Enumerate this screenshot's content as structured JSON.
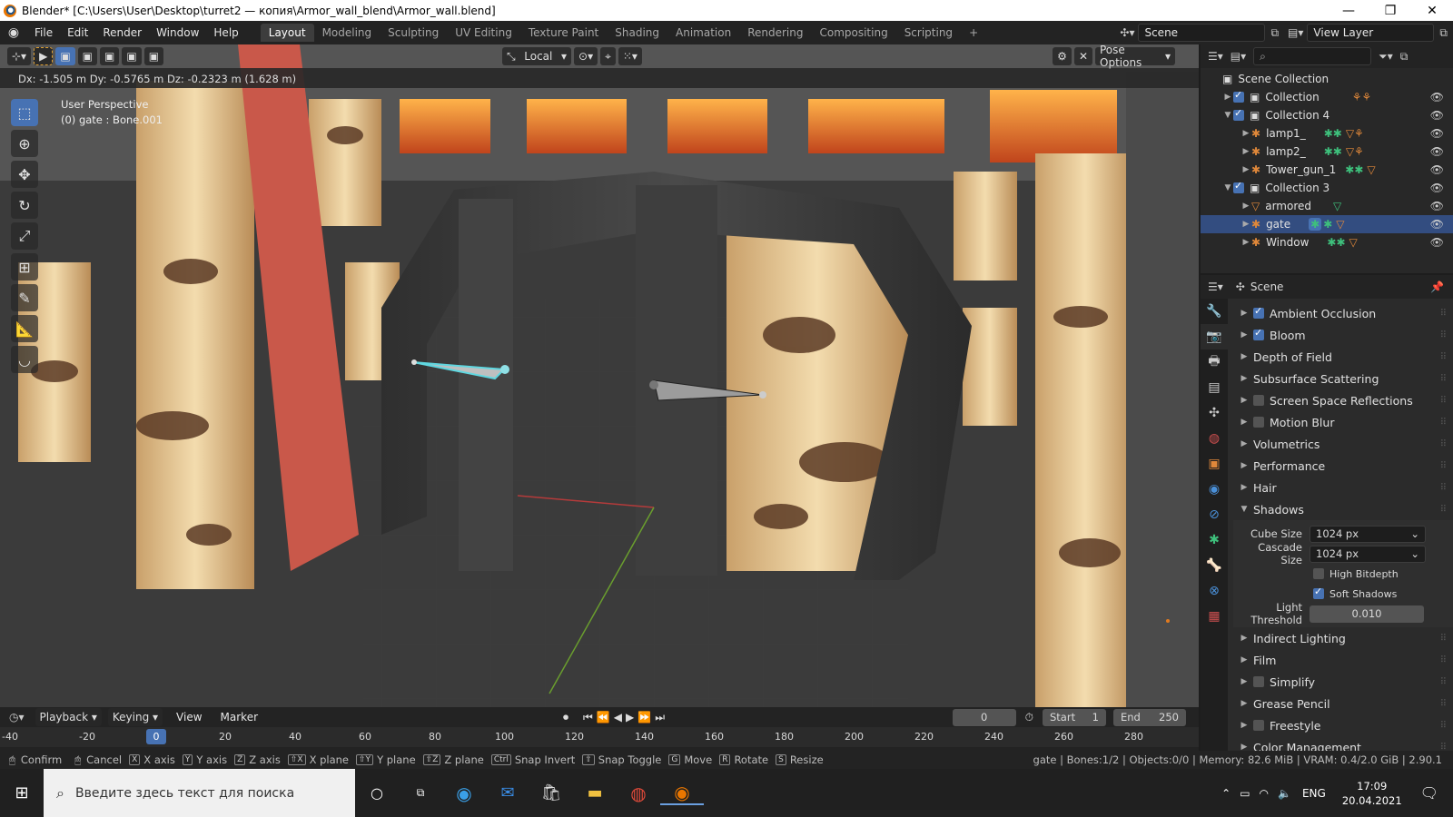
{
  "window": {
    "title": "Blender* [C:\\Users\\User\\Desktop\\turret2 — копия\\Armor_wall_blend\\Armor_wall.blend]",
    "minimize": "—",
    "maximize": "❐",
    "close": "✕"
  },
  "menus": [
    "File",
    "Edit",
    "Render",
    "Window",
    "Help"
  ],
  "workspaces": [
    "Layout",
    "Modeling",
    "Sculpting",
    "UV Editing",
    "Texture Paint",
    "Shading",
    "Animation",
    "Rendering",
    "Compositing",
    "Scripting"
  ],
  "active_workspace": "Layout",
  "scene_field": "Scene",
  "view_layer_field": "View Layer",
  "viewport": {
    "transform_readout": "Dx: -1.505 m  Dy: -0.5765 m  Dz: -0.2323 m (1.628 m)",
    "perspective": "User Perspective",
    "object_info": "(0) gate : Bone.001",
    "orientation": "Local",
    "pose_options": "Pose Options"
  },
  "tools": [
    "select-box",
    "cursor",
    "move",
    "rotate",
    "scale",
    "transform",
    "annotate",
    "measure",
    "bone-roll"
  ],
  "outliner": {
    "root": "Scene Collection",
    "rows": [
      {
        "label": "Collection",
        "indent": 1,
        "type": "collection",
        "expanded": false,
        "checked": true
      },
      {
        "label": "Collection 4",
        "indent": 1,
        "type": "collection",
        "expanded": true,
        "checked": true
      },
      {
        "label": "lamp1_",
        "indent": 2,
        "type": "armature"
      },
      {
        "label": "lamp2_",
        "indent": 2,
        "type": "armature"
      },
      {
        "label": "Tower_gun_1",
        "indent": 2,
        "type": "armature"
      },
      {
        "label": "Collection 3",
        "indent": 1,
        "type": "collection",
        "expanded": true,
        "checked": true
      },
      {
        "label": "armored",
        "indent": 2,
        "type": "mesh"
      },
      {
        "label": "gate",
        "indent": 2,
        "type": "armature",
        "selected": true
      },
      {
        "label": "Window",
        "indent": 2,
        "type": "armature"
      }
    ]
  },
  "properties": {
    "context": "Scene",
    "panels": [
      {
        "label": "Ambient Occlusion",
        "checkbox": true,
        "checked": true
      },
      {
        "label": "Bloom",
        "checkbox": true,
        "checked": true
      },
      {
        "label": "Depth of Field",
        "checkbox": false
      },
      {
        "label": "Subsurface Scattering",
        "checkbox": false
      },
      {
        "label": "Screen Space Reflections",
        "checkbox": true,
        "checked": false
      },
      {
        "label": "Motion Blur",
        "checkbox": true,
        "checked": false
      },
      {
        "label": "Volumetrics",
        "checkbox": false
      },
      {
        "label": "Performance",
        "checkbox": false
      },
      {
        "label": "Hair",
        "checkbox": false
      }
    ],
    "shadows": {
      "label": "Shadows",
      "cube_size_label": "Cube Size",
      "cube_size": "1024 px",
      "cascade_size_label": "Cascade Size",
      "cascade_size": "1024 px",
      "high_bitdepth": "High Bitdepth",
      "high_bitdepth_checked": false,
      "soft_shadows": "Soft Shadows",
      "soft_shadows_checked": true,
      "light_threshold_label": "Light Threshold",
      "light_threshold": "0.010"
    },
    "panels_after": [
      {
        "label": "Indirect Lighting",
        "checkbox": false
      },
      {
        "label": "Film",
        "checkbox": false
      },
      {
        "label": "Simplify",
        "checkbox": true,
        "checked": false
      },
      {
        "label": "Grease Pencil",
        "checkbox": false
      },
      {
        "label": "Freestyle",
        "checkbox": true,
        "checked": false
      },
      {
        "label": "Color Management",
        "checkbox": false
      }
    ]
  },
  "timeline": {
    "menus": [
      "Playback",
      "Keying",
      "View",
      "Marker"
    ],
    "current_frame": "0",
    "start_label": "Start",
    "start": "1",
    "end_label": "End",
    "end": "250",
    "ruler": [
      "-40",
      "-20",
      "0",
      "20",
      "40",
      "60",
      "80",
      "100",
      "120",
      "140",
      "160",
      "180",
      "200",
      "220",
      "240",
      "260",
      "280"
    ]
  },
  "statusbar": {
    "hints": [
      {
        "key": "",
        "label": "Confirm"
      },
      {
        "key": "",
        "label": "Cancel"
      },
      {
        "key": "X",
        "label": "X axis"
      },
      {
        "key": "Y",
        "label": "Y axis"
      },
      {
        "key": "Z",
        "label": "Z axis"
      },
      {
        "key": "⇧X",
        "label": "X plane"
      },
      {
        "key": "⇧Y",
        "label": "Y plane"
      },
      {
        "key": "⇧Z",
        "label": "Z plane"
      },
      {
        "key": "Ctrl",
        "label": "Snap Invert"
      },
      {
        "key": "⇧",
        "label": "Snap Toggle"
      },
      {
        "key": "G",
        "label": "Move"
      },
      {
        "key": "R",
        "label": "Rotate"
      },
      {
        "key": "S",
        "label": "Resize"
      }
    ],
    "stats": "gate | Bones:1/2 | Objects:0/0 | Memory: 82.6 MiB | VRAM: 0.4/2.0 GiB | 2.90.1"
  },
  "taskbar": {
    "search_placeholder": "Введите здесь текст для поиска",
    "lang": "ENG",
    "time": "17:09",
    "date": "20.04.2021"
  },
  "colors": {
    "accent": "#4772b3",
    "orange": "#e0883a",
    "selected_row": "#334d80"
  }
}
